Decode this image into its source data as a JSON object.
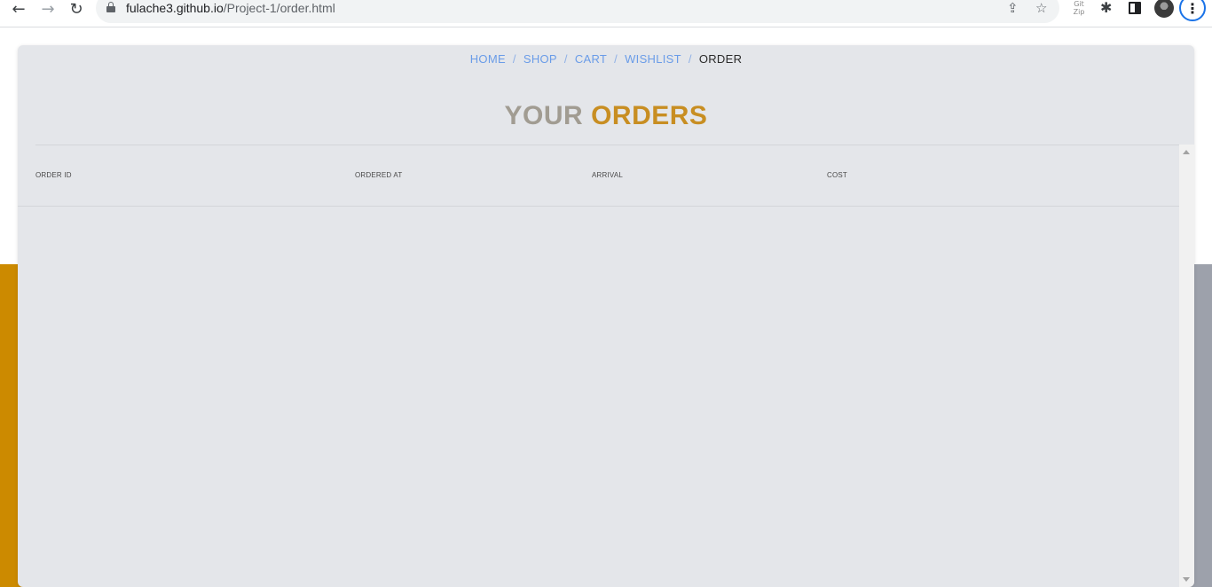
{
  "browser": {
    "url_domain": "fulache3.github.io",
    "url_path": "/Project-1/order.html",
    "icons": {
      "back": "arrow-left",
      "forward": "arrow-right",
      "reload": "reload",
      "lock": "lock",
      "share": "share",
      "bookmark": "star",
      "gitzip": "gitzip-extension",
      "extensions": "puzzle",
      "side_panel": "side-panel",
      "profile": "avatar",
      "menu": "vertical-dots"
    },
    "ext_gitzip_label": "Git\nZip"
  },
  "breadcrumb": {
    "items": [
      "HOME",
      "SHOP",
      "CART",
      "WISHLIST"
    ],
    "separator": "/",
    "current": "ORDER"
  },
  "title": {
    "part1": "YOUR",
    "part2": "ORDERS"
  },
  "table": {
    "columns": [
      "ORDER ID",
      "ORDERED AT",
      "ARRIVAL",
      "COST"
    ],
    "rows": []
  },
  "colors": {
    "title_part1": "#a19c92",
    "title_part2": "#c88e22",
    "link": "#6a9ce8",
    "modal_bg": "#e4e6ea",
    "bg_left": "#cc8a00",
    "bg_right": "#9da1ab"
  }
}
